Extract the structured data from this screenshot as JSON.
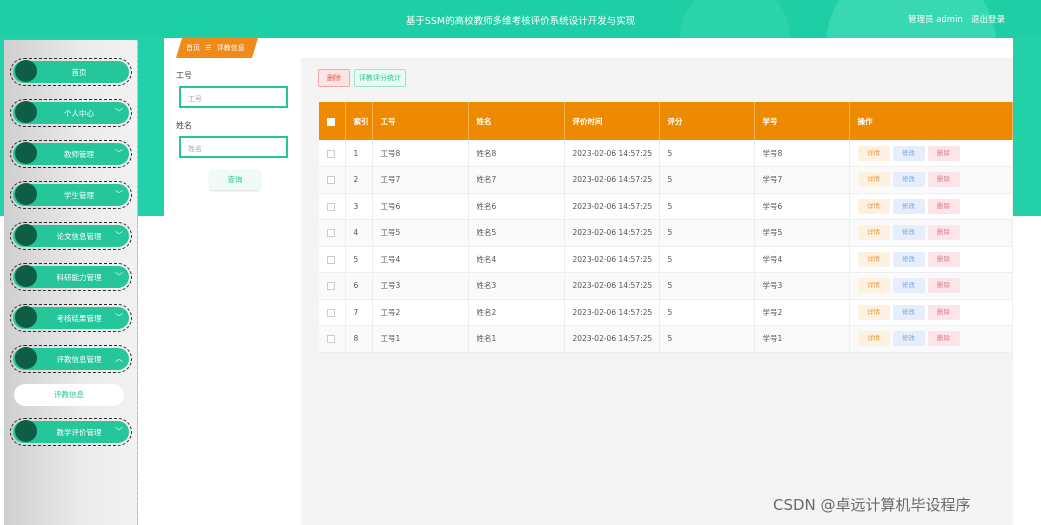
{
  "header": {
    "title": "基于SSM的高校教师多维考核评价系统设计开发与实现",
    "user": "管理员 admin",
    "logout": "退出登录"
  },
  "sidebar": {
    "items": [
      {
        "label": "首页",
        "chevron": ""
      },
      {
        "label": "个人中心",
        "chevron": "﹀"
      },
      {
        "label": "教师管理",
        "chevron": "﹀"
      },
      {
        "label": "学生管理",
        "chevron": "﹀"
      },
      {
        "label": "论文信息管理",
        "chevron": "﹀"
      },
      {
        "label": "科研能力管理",
        "chevron": "﹀"
      },
      {
        "label": "考核结果管理",
        "chevron": "﹀"
      },
      {
        "label": "评教信息管理",
        "chevron": "︿"
      },
      {
        "label": "教学评价管理",
        "chevron": "﹀"
      }
    ],
    "sub_item": "评教信息"
  },
  "breadcrumb": {
    "home": "首页",
    "separator": "☰",
    "current": "评教信息"
  },
  "search": {
    "field1_label": "工号",
    "field1_placeholder": "工号",
    "field2_label": "姓名",
    "field2_placeholder": "姓名",
    "button": "查询"
  },
  "toolbar": {
    "delete": "删除",
    "stats": "评教评分统计"
  },
  "table": {
    "headers": [
      "索引",
      "工号",
      "姓名",
      "评价时间",
      "评分",
      "学号",
      "操作"
    ],
    "rows": [
      [
        "1",
        "工号8",
        "姓名8",
        "2023-02-06 14:57:25",
        "5",
        "学号8"
      ],
      [
        "2",
        "工号7",
        "姓名7",
        "2023-02-06 14:57:25",
        "5",
        "学号7"
      ],
      [
        "3",
        "工号6",
        "姓名6",
        "2023-02-06 14:57:25",
        "5",
        "学号6"
      ],
      [
        "4",
        "工号5",
        "姓名5",
        "2023-02-06 14:57:25",
        "5",
        "学号5"
      ],
      [
        "5",
        "工号4",
        "姓名4",
        "2023-02-06 14:57:25",
        "5",
        "学号4"
      ],
      [
        "6",
        "工号3",
        "姓名3",
        "2023-02-06 14:57:25",
        "5",
        "学号3"
      ],
      [
        "7",
        "工号2",
        "姓名2",
        "2023-02-06 14:57:25",
        "5",
        "学号2"
      ],
      [
        "8",
        "工号1",
        "姓名1",
        "2023-02-06 14:57:25",
        "5",
        "学号1"
      ]
    ],
    "actions": {
      "detail": "详情",
      "edit": "修改",
      "delete": "删除"
    }
  },
  "watermark": "CSDN @卓远计算机毕设程序",
  "colors": {
    "brand_green": "#1ecfa5",
    "accent_orange": "#ee8a00",
    "menu_dot": "#0d5e44"
  }
}
